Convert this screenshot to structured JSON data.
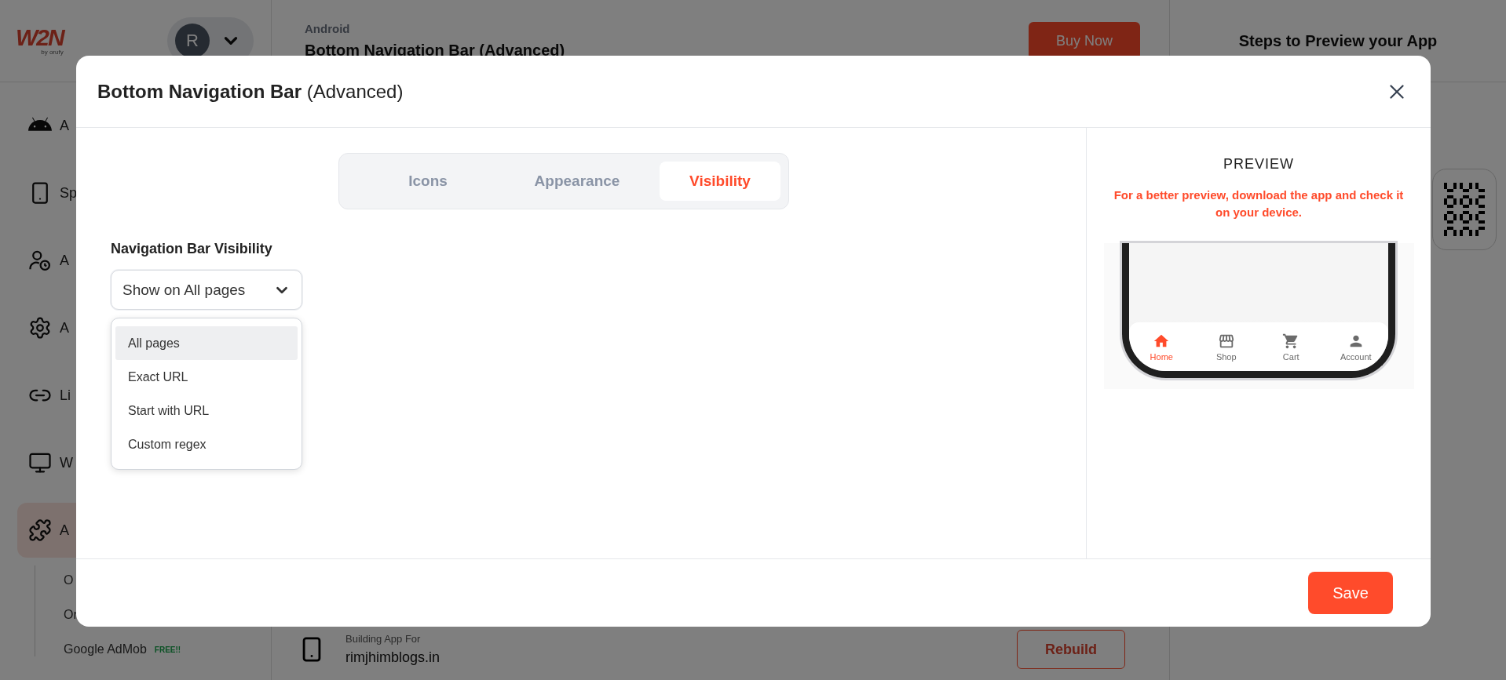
{
  "app_bar": {
    "logo": "W2N",
    "logo_caption": "by orufy",
    "avatar": "R",
    "platform": "Android",
    "page_title": "Bottom Navigation Bar (Advanced)",
    "buy_button": "Buy Now",
    "steps_title": "Steps to Preview your App"
  },
  "sidebar": {
    "items": [
      {
        "kind": "android",
        "label": "A",
        "selected": false
      },
      {
        "kind": "phone",
        "label": "Sp",
        "selected": false
      },
      {
        "kind": "user-clock",
        "label": "A",
        "selected": false
      },
      {
        "kind": "gear",
        "label": "A",
        "selected": false
      },
      {
        "kind": "link",
        "label": "Li",
        "selected": false
      },
      {
        "kind": "monitor",
        "label": "W",
        "selected": false
      },
      {
        "kind": "puzzle",
        "label": "A",
        "selected": true
      }
    ],
    "sub_items": [
      {
        "label": "O"
      },
      {
        "label": "Or"
      },
      {
        "label": "Google AdMob",
        "badge": "FREE!!"
      }
    ]
  },
  "build_card": {
    "caption": "Building App For",
    "domain": "rimjhimblogs.in",
    "button": "Rebuild"
  },
  "modal": {
    "title": "**Bottom Navigation Bar** (Advanced)",
    "tabs": [
      {
        "label": "Icons",
        "selected": false
      },
      {
        "label": "Appearance",
        "selected": false
      },
      {
        "label": "Visibility",
        "selected": true
      }
    ],
    "field_label": "Navigation Bar Visibility",
    "select": {
      "value": "Show on All pages",
      "expanded": true,
      "options": [
        {
          "label": "All pages",
          "selected": true
        },
        {
          "label": "Exact URL",
          "selected": false
        },
        {
          "label": "Start with URL",
          "selected": false
        },
        {
          "label": "Custom regex",
          "selected": false
        }
      ]
    },
    "preview": {
      "heading": "PREVIEW",
      "note": "For a better preview, download the app and check it on your device.",
      "nav_items": [
        {
          "kind": "home",
          "label": "Home",
          "selected": true
        },
        {
          "kind": "shop",
          "label": "Shop",
          "selected": false
        },
        {
          "kind": "cart",
          "label": "Cart",
          "selected": false
        },
        {
          "kind": "account",
          "label": "Account",
          "selected": false
        }
      ]
    },
    "save_button": "Save"
  }
}
